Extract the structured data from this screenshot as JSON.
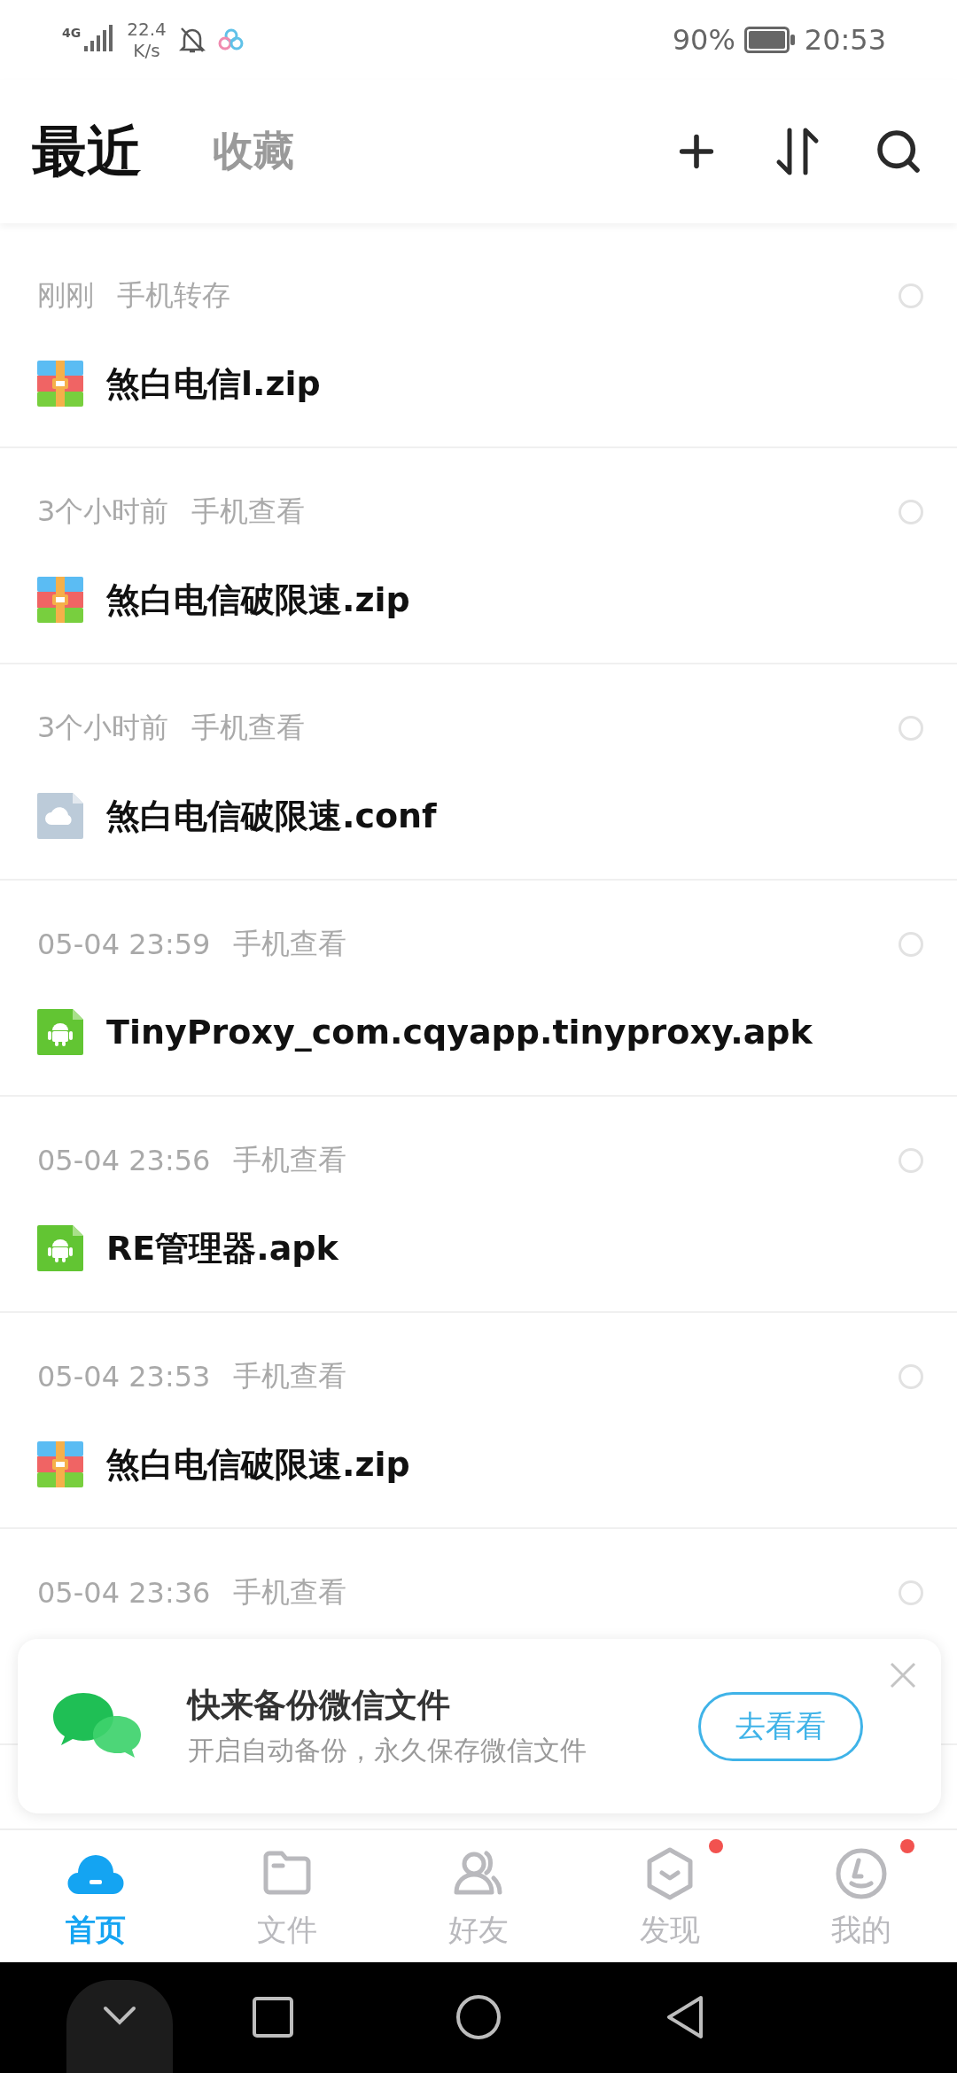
{
  "status_bar": {
    "network": "4G",
    "speed": "22.4",
    "speed_unit": "K/s",
    "battery": "90%",
    "time": "20:53"
  },
  "tabs": [
    {
      "label": "最近",
      "selected": true
    },
    {
      "label": "收藏",
      "selected": false
    }
  ],
  "files": [
    {
      "time": "刚刚",
      "source": "手机转存",
      "name": "煞白电信l.zip",
      "kind": "zip",
      "checked": false
    },
    {
      "time": "3个小时前",
      "source": "手机查看",
      "name": "煞白电信破限速.zip",
      "kind": "zip",
      "checked": false
    },
    {
      "time": "3个小时前",
      "source": "手机查看",
      "name": "煞白电信破限速.conf",
      "kind": "cloud",
      "checked": false
    },
    {
      "time": "05-04 23:59",
      "source": "手机查看",
      "name": "TinyProxy_com.cqyapp.tinyproxy.apk",
      "kind": "apk",
      "checked": false
    },
    {
      "time": "05-04 23:56",
      "source": "手机查看",
      "name": "RE管理器.apk",
      "kind": "apk",
      "checked": false
    },
    {
      "time": "05-04 23:53",
      "source": "手机查看",
      "name": "煞白电信破限速.zip",
      "kind": "zip",
      "checked": false
    },
    {
      "time": "05-04 23:36",
      "source": "手机查看",
      "checked": false
    }
  ],
  "banner": {
    "title": "快来备份微信文件",
    "subtitle": "开启自动备份，永久保存微信文件",
    "button": "去看看"
  },
  "nav": [
    {
      "label": "首页",
      "kind": "home",
      "selected": true,
      "badge": false
    },
    {
      "label": "文件",
      "kind": "files",
      "selected": false,
      "badge": false
    },
    {
      "label": "好友",
      "kind": "friends",
      "selected": false,
      "badge": false
    },
    {
      "label": "发现",
      "kind": "discover",
      "selected": false,
      "badge": true
    },
    {
      "label": "我的",
      "kind": "me",
      "selected": false,
      "badge": true
    }
  ]
}
